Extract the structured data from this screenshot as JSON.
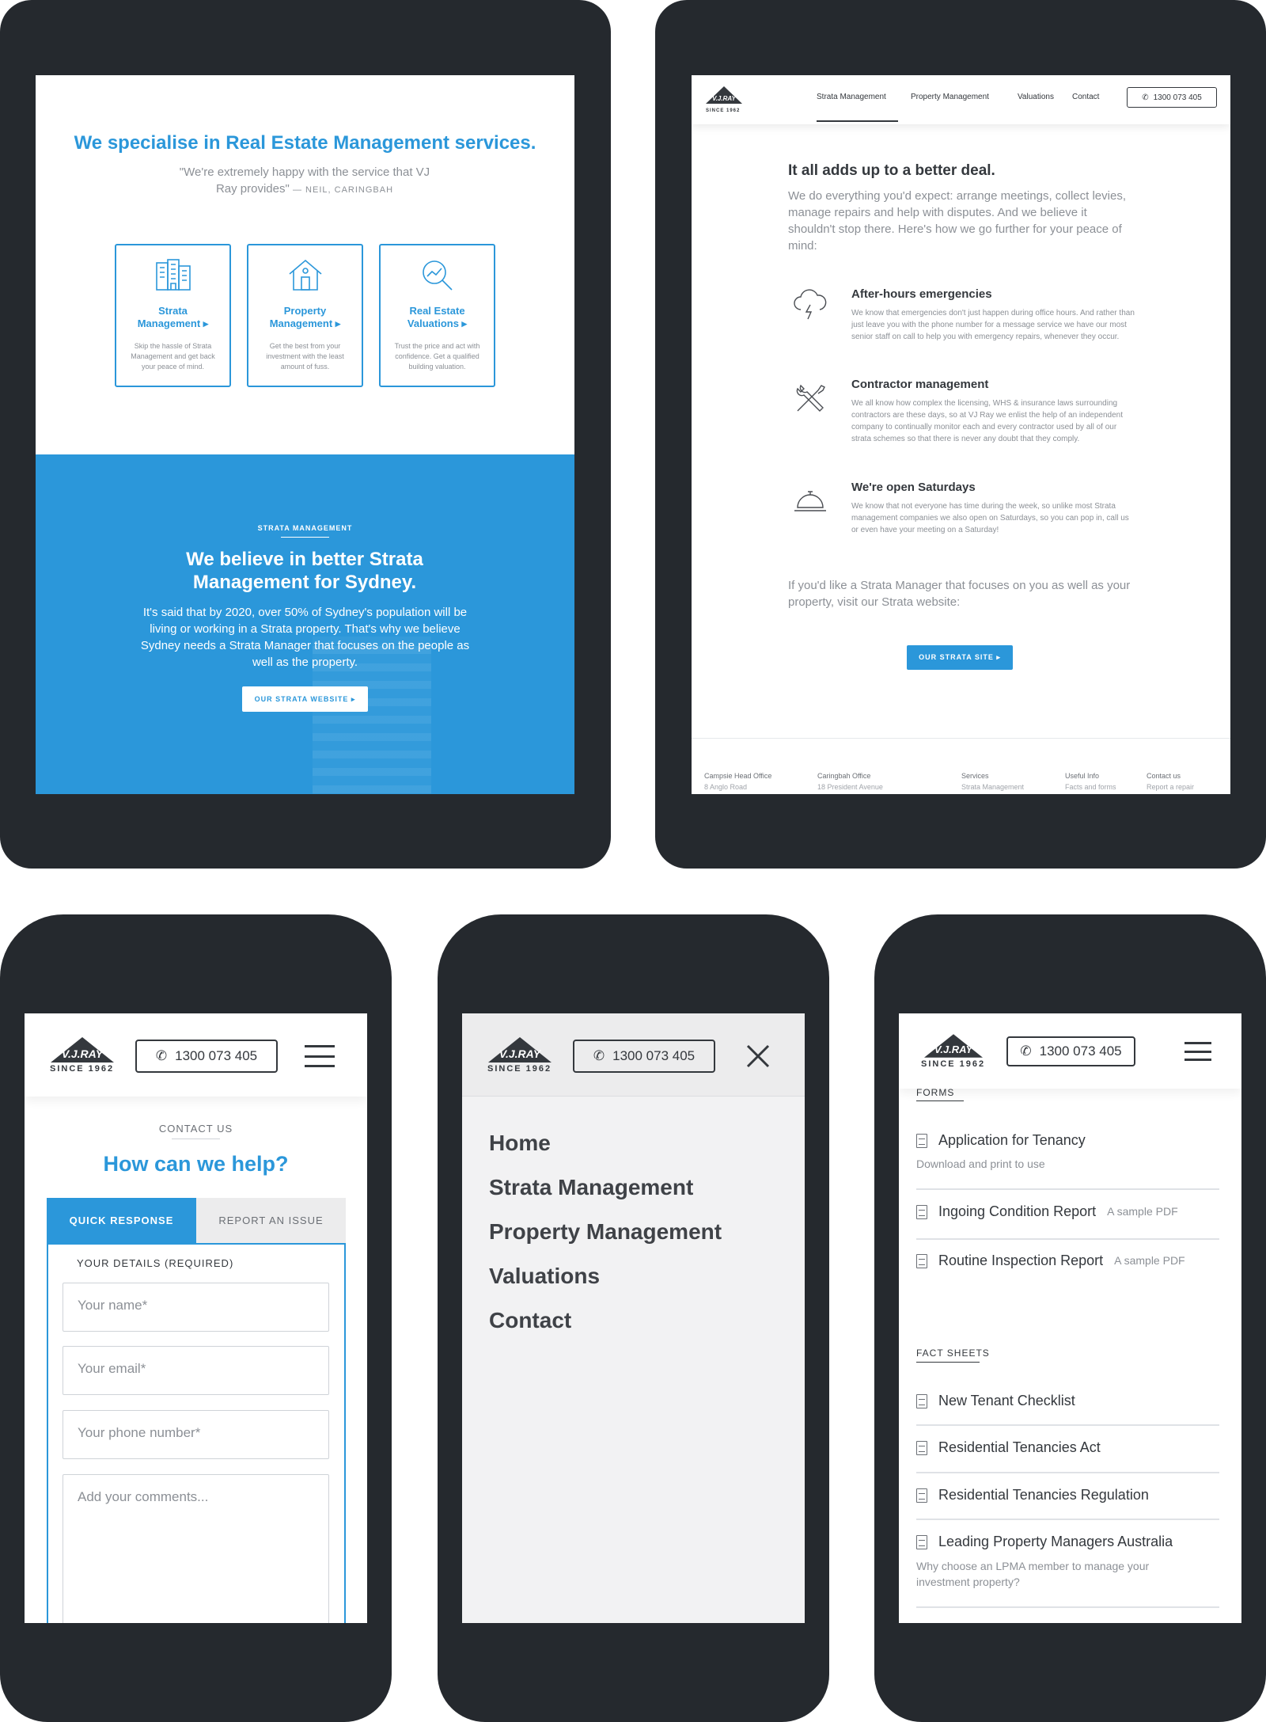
{
  "tablet1": {
    "headline": "We specialise in Real Estate Management services.",
    "quote": "\"We're extremely happy with the service that VJ Ray provides\"",
    "quote_author": "— NEIL, CARINGBAH",
    "cards": [
      {
        "title": "Strata Management ▸",
        "desc": "Skip the hassle of Strata Management and get back your peace of mind."
      },
      {
        "title": "Property Management ▸",
        "desc": "Get the best from your investment with the least amount of fuss."
      },
      {
        "title": "Real Estate Valuations ▸",
        "desc": "Trust the price and act with confidence. Get a qualified building valuation."
      }
    ],
    "section_label": "STRATA MANAGEMENT",
    "section_title": "We believe in better Strata Management for Sydney.",
    "section_body": "It's said that by 2020, over 50% of Sydney's population will be living or working in a Strata property. That's why we believe Sydney needs a Strata Manager that focuses on the people as well as the property.",
    "section_button": "OUR STRATA WEBSITE ▸"
  },
  "tablet2": {
    "logo_text": "V.J.RAY",
    "logo_since": "SINCE 1962",
    "nav": [
      "Strata Management",
      "Property Management",
      "Valuations",
      "Contact"
    ],
    "phone": "1300 073 405",
    "title": "It all adds up to a better deal.",
    "intro": "We do everything you'd expect: arrange meetings, collect levies, manage repairs and help with disputes. And we believe it shouldn't stop there. Here's how we go further for your peace of mind:",
    "features": [
      {
        "title": "After-hours emergencies",
        "desc": "We know that emergencies don't just happen during office hours. And rather than just leave you with the phone number for a message service we have our most senior staff on call to help you with emergency repairs, whenever they occur."
      },
      {
        "title": "Contractor management",
        "desc": "We all know how complex the licensing, WHS & insurance laws surrounding contractors are these days, so at VJ Ray we enlist the help of an independent company to continually monitor each and every contractor used by all of our strata schemes so that there is never any doubt that they comply."
      },
      {
        "title": "We're open Saturdays",
        "desc": "We know that not everyone has time during the week, so unlike most Strata management companies we also open on Saturdays, so you can pop in, call us or even have your meeting on a Saturday!"
      }
    ],
    "outro": "If you'd like a Strata Manager that focuses on you as well as your property, visit our Strata website:",
    "button": "OUR STRATA SITE ▸",
    "footer": [
      {
        "head": "Campsie Head Office",
        "sub": "8 Anglo Road"
      },
      {
        "head": "Caringbah Office",
        "sub": "18 President Avenue"
      },
      {
        "head": "Services",
        "sub": "Strata Management"
      },
      {
        "head": "Useful Info",
        "sub": "Facts and forms"
      },
      {
        "head": "Contact us",
        "sub": "Report a repair"
      }
    ]
  },
  "phone1": {
    "phone": "1300 073 405",
    "label": "CONTACT US",
    "title": "How can we help?",
    "tabs": [
      "QUICK RESPONSE",
      "REPORT AN ISSUE"
    ],
    "details_label": "YOUR DETAILS (REQUIRED)",
    "name_placeholder": "Your name*",
    "email_placeholder": "Your email*",
    "phone_placeholder": "Your phone number*",
    "comments_placeholder": "Add your comments..."
  },
  "phone2": {
    "phone": "1300 073 405",
    "menu": [
      "Home",
      "Strata Management",
      "Property Management",
      "Valuations",
      "Contact"
    ]
  },
  "phone3": {
    "phone": "1300 073 405",
    "forms_label": "FORMS",
    "forms": [
      {
        "title": "Application for Tenancy",
        "sub": "Download and print to use"
      },
      {
        "title": "Ingoing Condition Report",
        "sub": "A sample PDF"
      },
      {
        "title": "Routine Inspection Report",
        "sub": "A sample PDF"
      }
    ],
    "facts_label": "FACT SHEETS",
    "facts": [
      {
        "title": "New Tenant Checklist"
      },
      {
        "title": "Residential Tenancies Act"
      },
      {
        "title": "Residential Tenancies Regulation"
      },
      {
        "title": "Leading Property Managers Australia",
        "sub": "Why choose an LPMA member to manage your investment property?"
      }
    ]
  },
  "colors": {
    "accent": "#2b97da",
    "device": "#25292e",
    "text": "#34383d"
  }
}
